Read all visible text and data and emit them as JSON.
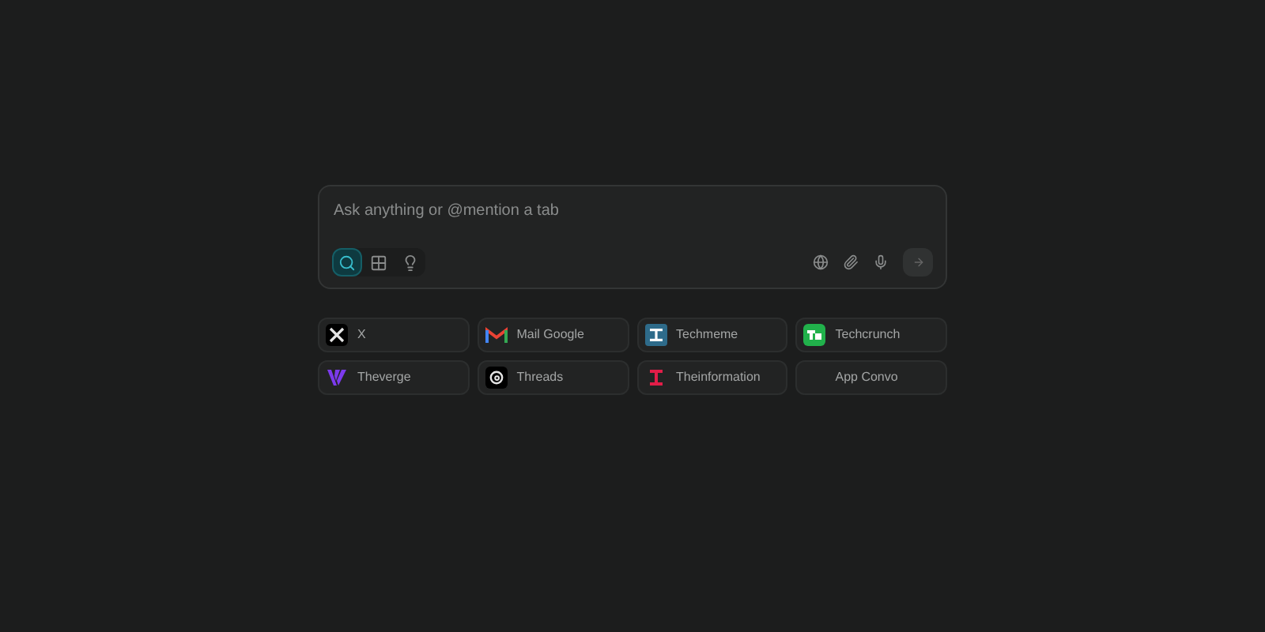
{
  "prompt": {
    "placeholder": "Ask anything or @mention a tab"
  },
  "modes": [
    {
      "kind": "search",
      "selected": true
    },
    {
      "kind": "grid",
      "selected": false
    },
    {
      "kind": "idea",
      "selected": false
    }
  ],
  "tools": [
    {
      "kind": "globe"
    },
    {
      "kind": "attach"
    },
    {
      "kind": "mic"
    }
  ],
  "shortcuts": [
    {
      "label": "X",
      "kind": "x"
    },
    {
      "label": "Mail Google",
      "kind": "mail"
    },
    {
      "label": "Techmeme",
      "kind": "techmeme"
    },
    {
      "label": "Techcrunch",
      "kind": "techcrunch"
    },
    {
      "label": "Theverge",
      "kind": "verge"
    },
    {
      "label": "Threads",
      "kind": "threads"
    },
    {
      "label": "Theinformation",
      "kind": "information"
    },
    {
      "label": "App Convo",
      "kind": "none"
    }
  ]
}
